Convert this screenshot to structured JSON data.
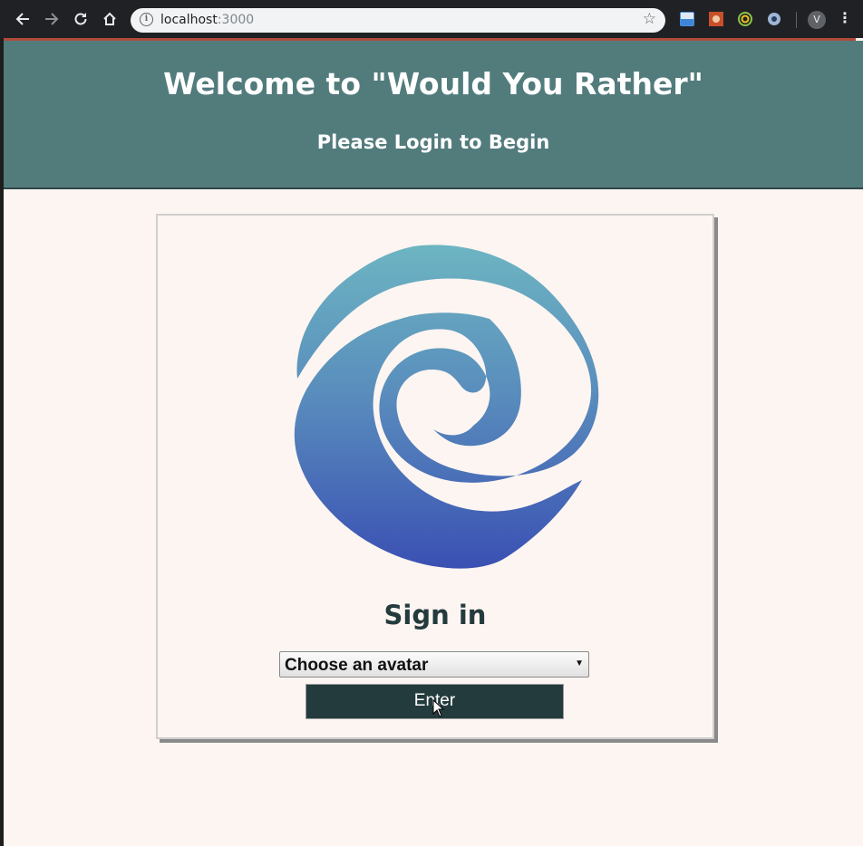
{
  "browser": {
    "url_host": "localhost",
    "url_port": ":3000",
    "profile_initial": "V",
    "icons": {
      "back": "arrow-left-icon",
      "forward": "arrow-right-icon",
      "reload": "reload-icon",
      "home": "home-icon",
      "info": "info-icon",
      "bookmark": "star-icon",
      "menu": "menu-dots-icon"
    }
  },
  "header": {
    "title": "Welcome to \"Would You Rather\"",
    "subtitle": "Please Login to Begin",
    "background": "#527b7c",
    "accent": "#b14a3a"
  },
  "signin": {
    "title": "Sign in",
    "select_value": "Choose an avatar",
    "enter_label": "Enter",
    "button_color": "#243b3d"
  }
}
